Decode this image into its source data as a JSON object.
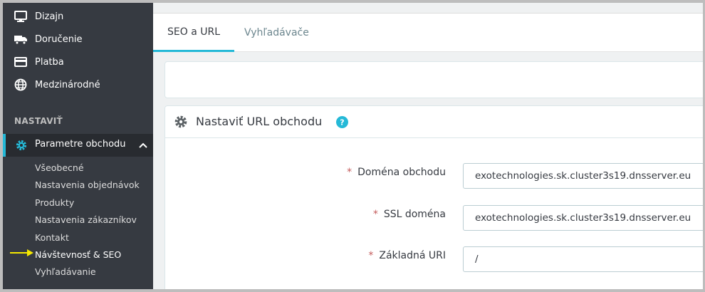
{
  "sidebar": {
    "items": [
      {
        "label": "Dizajn",
        "icon": "monitor-icon"
      },
      {
        "label": "Doručenie",
        "icon": "truck-icon"
      },
      {
        "label": "Platba",
        "icon": "credit-card-icon"
      },
      {
        "label": "Medzinárodné",
        "icon": "globe-icon"
      }
    ],
    "section_title": "NASTAVIŤ",
    "active_parent": {
      "label": "Parametre obchodu",
      "icon": "gear-icon"
    },
    "sub_items": [
      "Všeobecné",
      "Nastavenia objednávok",
      "Produkty",
      "Nastavenia zákazníkov",
      "Kontakt",
      "Návštevnosť & SEO",
      "Vyhľadávanie"
    ],
    "current_sub_index": 5
  },
  "tabs": [
    "SEO a URL",
    "Vyhľadávače"
  ],
  "active_tab_index": 0,
  "card": {
    "title": "Nastaviť URL obchodu",
    "fields": [
      {
        "label": "Doména obchodu",
        "value": "exotechnologies.sk.cluster3s19.dnsserver.eu",
        "required": "*"
      },
      {
        "label": "SSL doména",
        "value": "exotechnologies.sk.cluster3s19.dnsserver.eu",
        "required": "*"
      },
      {
        "label": "Základná URI",
        "value": "/",
        "required": "*"
      }
    ]
  },
  "colors": {
    "sidebar_bg": "#363a41",
    "accent": "#25b9d7",
    "arrow": "#f5e800"
  }
}
